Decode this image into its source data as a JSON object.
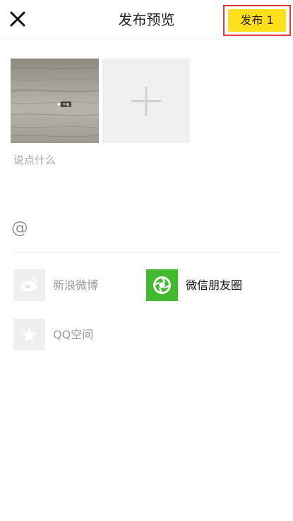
{
  "header": {
    "title": "发布预览",
    "close_icon": "close-icon",
    "publish_label": "发布 1"
  },
  "media": {
    "thumbnail_tag": "千图",
    "add_icon": "plus-icon"
  },
  "compose": {
    "placeholder": "说点什么",
    "mention_symbol": "@"
  },
  "share_targets": [
    {
      "label": "新浪微博",
      "icon": "weibo-icon",
      "selected": false
    },
    {
      "label": "微信朋友圈",
      "icon": "wechat-moments-icon",
      "selected": true
    },
    {
      "label": "QQ空间",
      "icon": "qzone-star-icon",
      "selected": false
    }
  ],
  "colors": {
    "publish_bg": "#ffe01a",
    "highlight_border": "#e53935",
    "wechat_green": "#44b82f",
    "disabled_icon_bg": "#efefef"
  }
}
